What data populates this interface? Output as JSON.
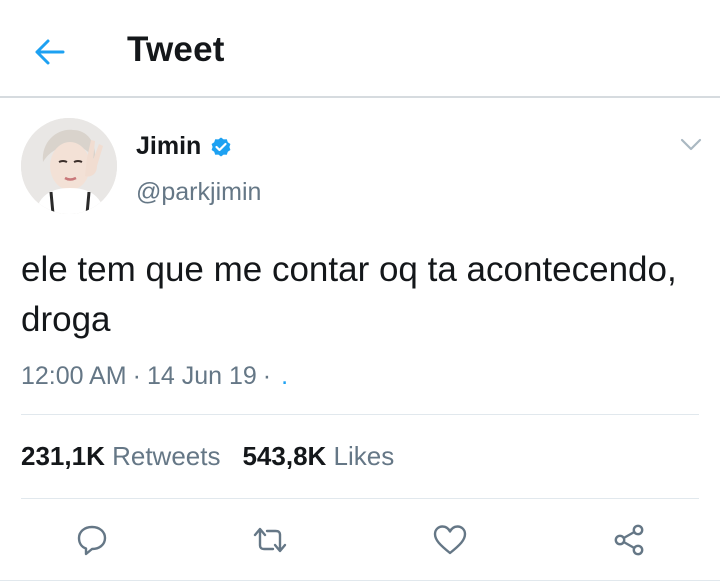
{
  "header": {
    "title": "Tweet",
    "back_icon": "arrow-left-icon"
  },
  "colors": {
    "accent": "#1da1f2",
    "text": "#14171a",
    "secondary": "#657786",
    "divider": "#e1e8ed"
  },
  "tweet": {
    "author_name": "Jimin",
    "verified_icon": "verified-badge-icon",
    "handle": "@parkjimin",
    "text": "ele tem que me contar oq ta acontecendo, droga",
    "time": "12:00 AM",
    "date": "14 Jun 19",
    "meta_trailing": "."
  },
  "stats": {
    "retweets_count": "231,1K",
    "retweets_label": "Retweets",
    "likes_count": "543,8K",
    "likes_label": "Likes"
  },
  "actions": [
    {
      "name": "reply",
      "icon": "comment-icon"
    },
    {
      "name": "retweet",
      "icon": "retweet-icon"
    },
    {
      "name": "like",
      "icon": "heart-icon"
    },
    {
      "name": "share",
      "icon": "share-icon"
    }
  ]
}
